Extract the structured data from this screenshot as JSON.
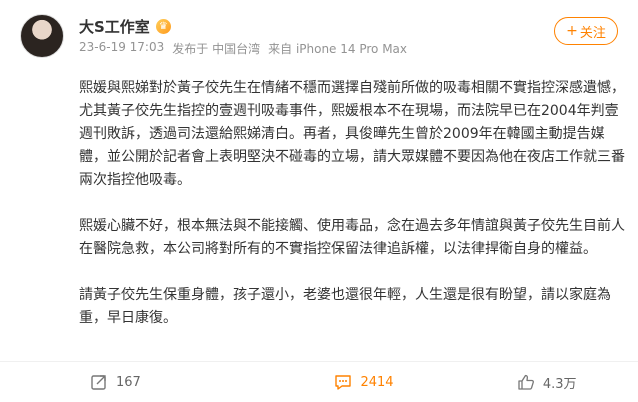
{
  "header": {
    "user_name": "大S工作室",
    "post_date": "23-6-19 17:03",
    "source_prefix": "发布于",
    "location": "中国台湾",
    "device_prefix": "来自",
    "device": "iPhone 14 Pro Max",
    "follow_label": "关注"
  },
  "content": {
    "paragraphs": [
      "熙媛與熙娣對於黃子佼先生在情緒不穩而選擇自殘前所做的吸毒相關不實指控深感遺憾，尤其黃子佼先生指控的壹週刊吸毒事件，熙媛根本不在現場，而法院早已在2004年判壹週刊敗訴，透過司法還給熙娣清白。再者，具俊曄先生曾於2009年在韓國主動提告媒體，並公開於記者會上表明堅決不碰毒的立場，請大眾媒體不要因為他在夜店工作就三番兩次指控他吸毒。",
      "熙媛心臟不好，根本無法與不能接觸、使用毒品，念在過去多年情誼與黃子佼先生目前人在醫院急救，本公司將對所有的不實指控保留法律追訴權，以法律捍衛自身的權益。",
      "請黃子佼先生保重身體，孩子還小，老婆也還很年輕，人生還是很有盼望，請以家庭為重，早日康復。"
    ]
  },
  "toolbar": {
    "repost_count": "167",
    "comment_count": "2414",
    "like_count": "4.3万"
  },
  "colors": {
    "accent": "#ff8200",
    "meta_text": "#939393"
  },
  "icons": {
    "vip": "vip-crown-icon",
    "repost": "repost-icon",
    "comment": "comment-icon",
    "like": "thumbs-up-icon"
  }
}
